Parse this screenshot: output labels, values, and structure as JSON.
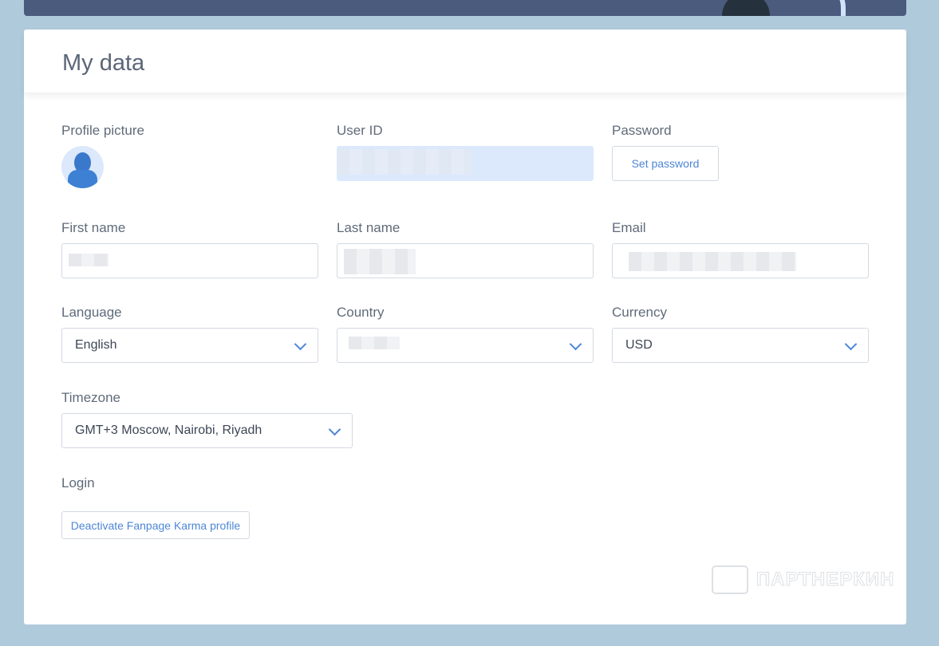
{
  "title": "My data",
  "fields": {
    "profile_picture": {
      "label": "Profile picture",
      "icon": "user-avatar-icon"
    },
    "user_id": {
      "label": "User ID"
    },
    "password": {
      "label": "Password",
      "button": "Set password"
    },
    "first_name": {
      "label": "First name"
    },
    "last_name": {
      "label": "Last name"
    },
    "email": {
      "label": "Email"
    },
    "language": {
      "label": "Language",
      "value": "English"
    },
    "country": {
      "label": "Country"
    },
    "currency": {
      "label": "Currency",
      "value": "USD"
    },
    "timezone": {
      "label": "Timezone",
      "value": "GMT+3 Moscow, Nairobi, Riyadh"
    },
    "login": {
      "label": "Login",
      "button": "Deactivate Fanpage Karma profile"
    }
  },
  "watermark": "ПАРТНЕРКИН"
}
